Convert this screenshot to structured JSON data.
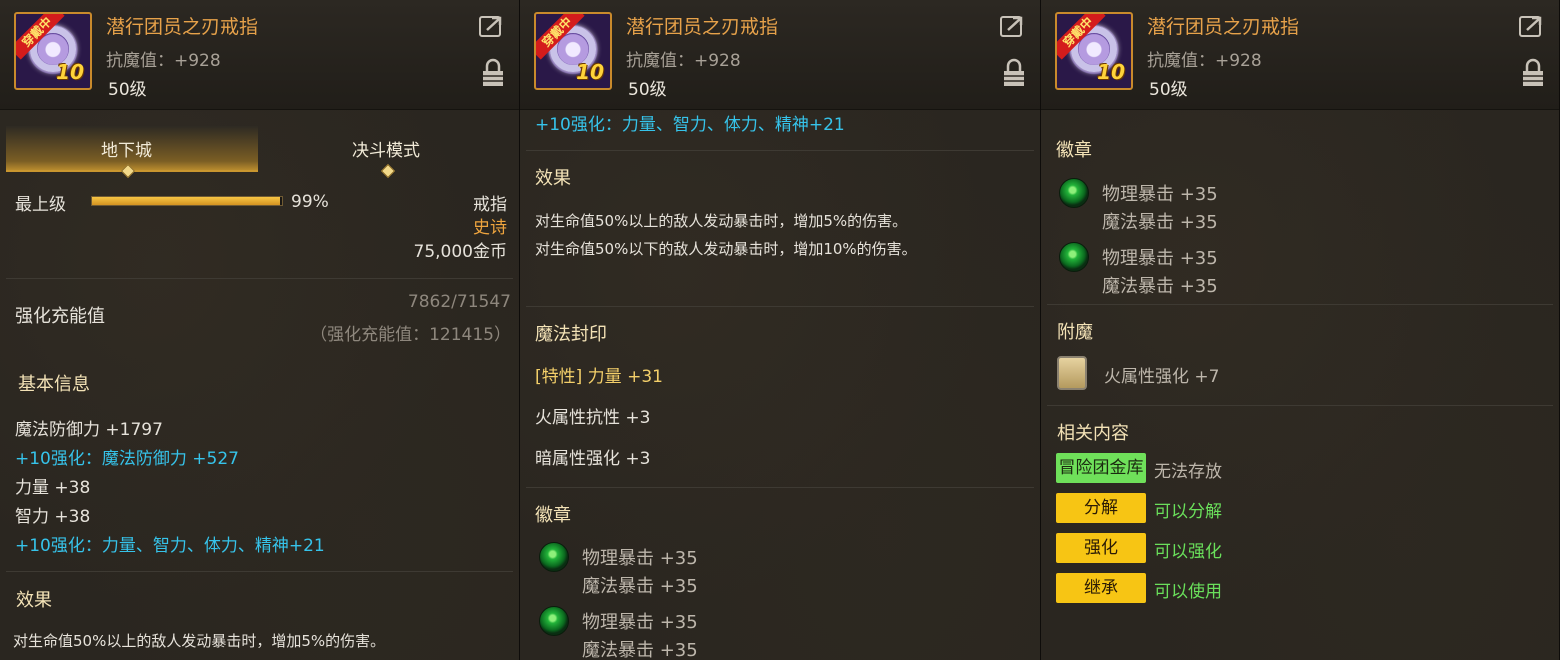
{
  "item": {
    "name": "潜行团员之刃戒指",
    "stat": "抗魔值：+928",
    "level": "50级",
    "equipped_badge": "穿戴中",
    "reinforce_level": "10"
  },
  "panel1": {
    "tabs": [
      "地下城",
      "决斗模式"
    ],
    "max_level_label": "最上级",
    "progress_percent": 99,
    "progress_text": "99%",
    "item_type": "戒指",
    "rarity": "史诗",
    "price": "75,000金币",
    "charge_label": "强化充能值",
    "charge_value": "7862/71547",
    "charge_total": "（强化充能值：121415）",
    "basic_info_title": "基本信息",
    "basic_lines": [
      "魔法防御力 +1797",
      "+10强化：魔法防御力 +527",
      "力量 +38",
      "智力 +38",
      "+10强化：力量、智力、体力、精神+21"
    ],
    "effect_title": "效果",
    "effect_partial": "对生命值50%以上的敌人发动暴击时，增加5%的伤害。"
  },
  "panel2": {
    "top_line": "+10强化：力量、智力、体力、精神+21",
    "effect_title": "效果",
    "effect_lines": [
      "对生命值50%以上的敌人发动暴击时，增加5%的伤害。",
      "对生命值50%以下的敌人发动暴击时，增加10%的伤害。"
    ],
    "seal_title": "魔法封印",
    "seal_lines": [
      "[特性] 力量 +31",
      "火属性抗性 +3",
      "暗属性强化 +3"
    ],
    "emblem_title": "徽章",
    "emblems": [
      [
        "物理暴击 +35",
        "魔法暴击 +35"
      ],
      [
        "物理暴击 +35",
        "魔法暴击 +35"
      ]
    ]
  },
  "panel3": {
    "emblem_title": "徽章",
    "emblems": [
      [
        "物理暴击 +35",
        "魔法暴击 +35"
      ],
      [
        "物理暴击 +35",
        "魔法暴击 +35"
      ]
    ],
    "enchant_title": "附魔",
    "enchant_value": "火属性强化 +7",
    "related_title": "相关内容",
    "related": [
      {
        "tag": "冒险团金库",
        "text": "无法存放",
        "tag_color": "green",
        "text_color": "#bdb6ab"
      },
      {
        "tag": "分解",
        "text": "可以分解",
        "tag_color": "yellow",
        "text_color": "#6ae05b"
      },
      {
        "tag": "强化",
        "text": "可以强化",
        "tag_color": "yellow",
        "text_color": "#6ae05b"
      },
      {
        "tag": "继承",
        "text": "可以使用",
        "tag_color": "yellow",
        "text_color": "#6ae05b"
      }
    ]
  }
}
